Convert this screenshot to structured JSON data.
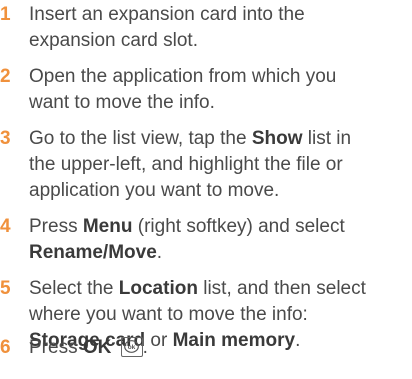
{
  "steps": [
    {
      "number": "1",
      "lines": [
        [
          {
            "t": "Insert an expansion card into the"
          }
        ],
        [
          {
            "t": "expansion card slot."
          }
        ]
      ]
    },
    {
      "number": "2",
      "lines": [
        [
          {
            "t": "Open the application from which you"
          }
        ],
        [
          {
            "t": "want to move the info."
          }
        ]
      ]
    },
    {
      "number": "3",
      "lines": [
        [
          {
            "t": "Go to the list view, tap the "
          },
          {
            "t": "Show",
            "b": true
          },
          {
            "t": " list in"
          }
        ],
        [
          {
            "t": "the upper-left, and highlight the file or"
          }
        ],
        [
          {
            "t": "application you want to move."
          }
        ]
      ]
    },
    {
      "number": "4",
      "lines": [
        [
          {
            "t": "Press "
          },
          {
            "t": "Menu",
            "b": true
          },
          {
            "t": " (right softkey) and select"
          }
        ],
        [
          {
            "t": "Rename/Move",
            "b": true
          },
          {
            "t": "."
          }
        ]
      ]
    },
    {
      "number": "5",
      "lines": [
        [
          {
            "t": "Select the "
          },
          {
            "t": "Location",
            "b": true
          },
          {
            "t": " list, and then select"
          }
        ],
        [
          {
            "t": "where you want to move the info:"
          }
        ],
        [
          {
            "t": "Storage card",
            "b": true
          },
          {
            "t": " or "
          },
          {
            "t": "Main memory",
            "b": true
          },
          {
            "t": "."
          }
        ]
      ]
    },
    {
      "number": "6",
      "lines": [
        [
          {
            "t": "Press "
          },
          {
            "t": "OK",
            "b": true
          },
          {
            "t": " "
          },
          {
            "icon": "ok-button-icon"
          },
          {
            "t": "."
          }
        ]
      ]
    }
  ],
  "colors": {
    "step_number": "#f0913c",
    "body_text": "#4a4a4a"
  }
}
